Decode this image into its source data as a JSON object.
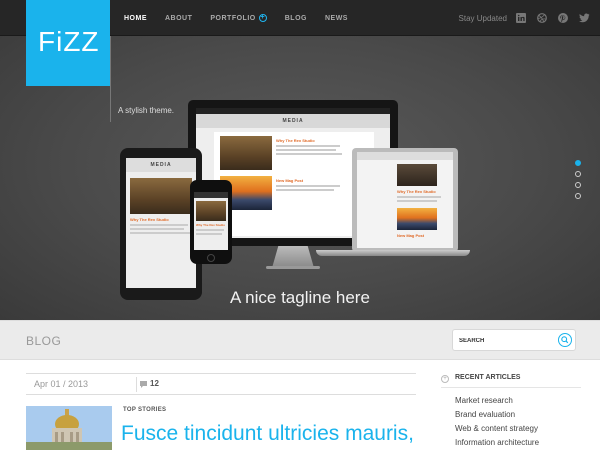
{
  "nav": {
    "items": [
      "HOME",
      "ABOUT",
      "PORTFOLIO",
      "BLOG",
      "NEWS"
    ],
    "stay_updated": "Stay Updated",
    "social_icons": [
      "linkedin-icon",
      "dribbble-icon",
      "pinterest-icon",
      "twitter-icon"
    ]
  },
  "brand": {
    "logo": "FiZZ",
    "slogan": "A stylish theme.",
    "color": "#1ab3ec"
  },
  "hero": {
    "tagline": "A nice tagline here",
    "slider_dots": 4,
    "active_dot": 0,
    "mockup": {
      "header": "MEDIA",
      "post1_title": "Why The Rex Studio",
      "post2_title": "New Mag Post"
    }
  },
  "blog": {
    "title": "BLOG",
    "search_placeholder": "SEARCH"
  },
  "post": {
    "date": "Apr 01 / 2013",
    "comments": "12",
    "category": "TOP STORIES",
    "title": "Fusce tincidunt ultricies mauris,"
  },
  "sidebar": {
    "heading": "RECENT ARTICLES",
    "items": [
      "Market research",
      "Brand evaluation",
      "Web & content strategy",
      "Information architecture"
    ]
  }
}
